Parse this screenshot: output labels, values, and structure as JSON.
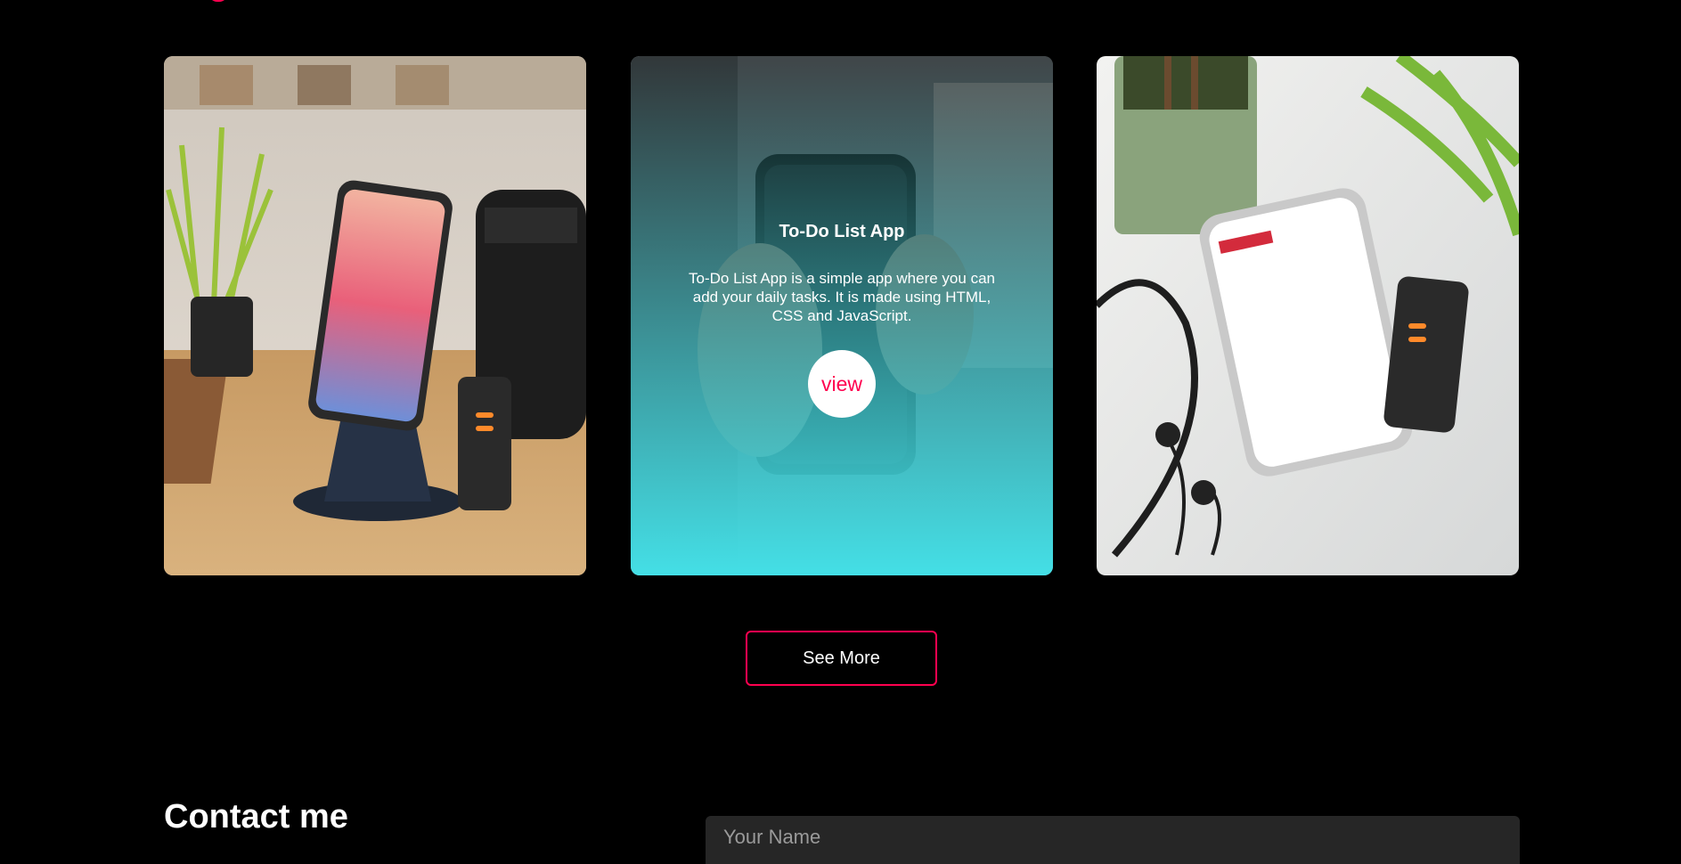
{
  "portfolio": {
    "works": [
      {
        "image": "phone-on-stand-desk-photo"
      },
      {
        "image": "phone-in-hand-photo",
        "title": "To-Do List App",
        "description": "To-Do List App is a simple app where you can add your daily tasks. It is made using HTML, CSS and JavaScript.",
        "view_label": "view"
      },
      {
        "image": "phone-us-store-photo"
      }
    ],
    "see_more_label": "See More"
  },
  "contact": {
    "title": "Contact me",
    "name_placeholder": "Your Name"
  },
  "colors": {
    "accent": "#ff004f",
    "background": "#000000",
    "overlay_gradient_end": "#44dfe6",
    "input_bg": "#262626"
  }
}
